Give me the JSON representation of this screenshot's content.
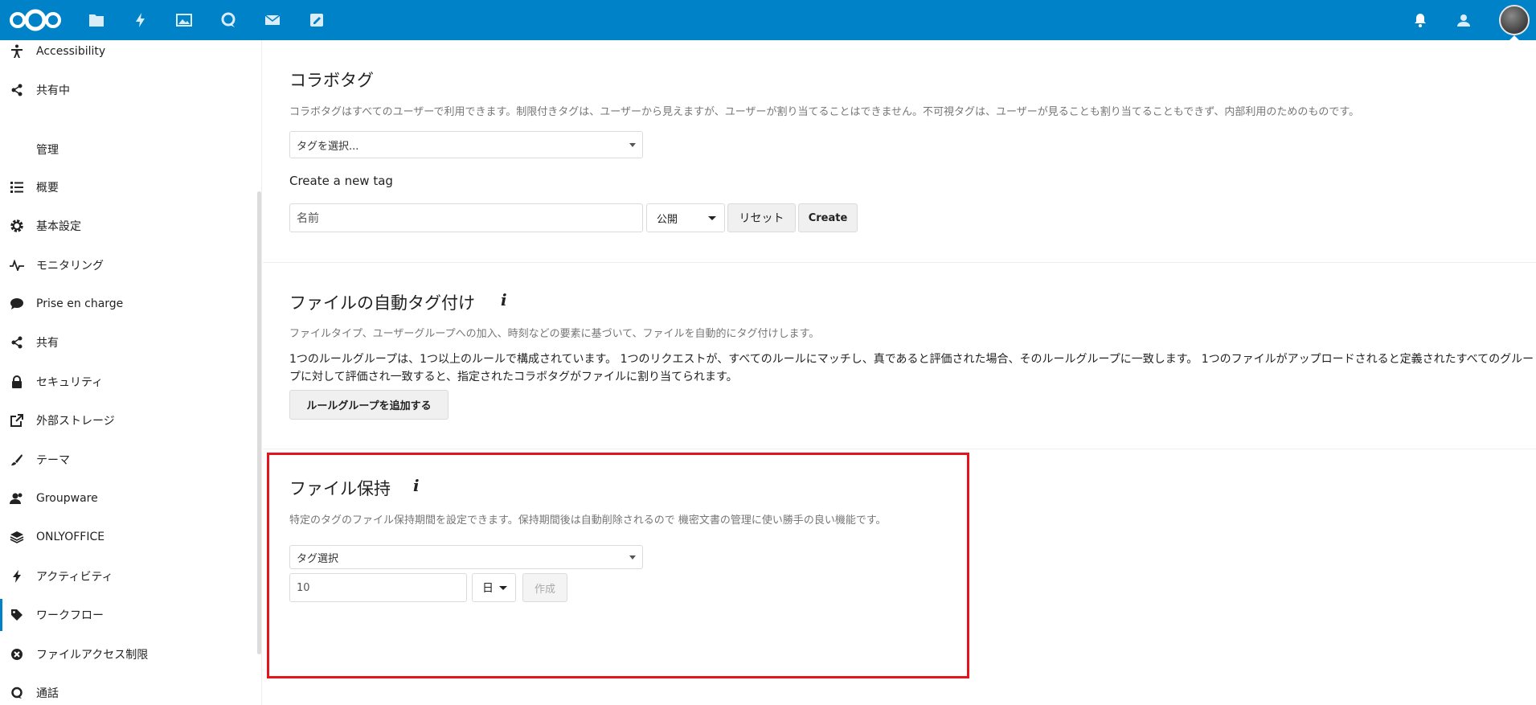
{
  "header": {
    "brand_color": "#0082c9",
    "apps": [
      {
        "icon": "files-icon"
      },
      {
        "icon": "activity-icon"
      },
      {
        "icon": "photos-icon"
      },
      {
        "icon": "talk-icon"
      },
      {
        "icon": "mail-icon"
      },
      {
        "icon": "notes-icon"
      }
    ],
    "right_icons": [
      "notifications-icon",
      "contacts-icon"
    ]
  },
  "sidebar": {
    "section_heading": "管理",
    "items": [
      {
        "label": "Accessibility",
        "icon": "accessibility-icon"
      },
      {
        "label": "共有中",
        "icon": "share-icon"
      },
      {
        "label": "概要",
        "icon": "list-icon"
      },
      {
        "label": "基本設定",
        "icon": "gear-icon"
      },
      {
        "label": "モニタリング",
        "icon": "pulse-icon"
      },
      {
        "label": "Prise en charge",
        "icon": "comment-icon"
      },
      {
        "label": "共有",
        "icon": "share-icon"
      },
      {
        "label": "セキュリティ",
        "icon": "lock-icon"
      },
      {
        "label": "外部ストレージ",
        "icon": "external-link-icon"
      },
      {
        "label": "テーマ",
        "icon": "brush-icon"
      },
      {
        "label": "Groupware",
        "icon": "group-icon"
      },
      {
        "label": "ONLYOFFICE",
        "icon": "layers-icon"
      },
      {
        "label": "アクティビティ",
        "icon": "activity-icon"
      },
      {
        "label": "ワークフロー",
        "icon": "tag-icon"
      },
      {
        "label": "ファイルアクセス制限",
        "icon": "block-icon"
      },
      {
        "label": "通話",
        "icon": "talk-icon"
      }
    ]
  },
  "collab_tags": {
    "title": "コラボタグ",
    "description": "コラボタグはすべてのユーザーで利用できます。制限付きタグは、ユーザーから見えますが、ユーザーが割り当てることはできません。不可視タグは、ユーザーが見ることも割り当てることもできず、内部利用のためのものです。",
    "select_placeholder": "タグを選択...",
    "create_label": "Create a new tag",
    "name_placeholder": "名前",
    "visibility_value": "公開",
    "reset_button": "リセット",
    "create_button": "Create"
  },
  "auto_tagging": {
    "title": "ファイルの自動タグ付け",
    "info_glyph": "i",
    "description": "ファイルタイプ、ユーザーグループへの加入、時刻などの要素に基づいて、ファイルを自動的にタグ付けします。",
    "body": "1つのルールグループは、1つ以上のルールで構成されています。 1つのリクエストが、すべてのルールにマッチし、真であると評価された場合、そのルールグループに一致します。 1つのファイルがアップロードされると定義されたすべてのグループに対して評価され一致すると、指定されたコラボタグがファイルに割り当てられます。",
    "add_button": "ルールグループを追加する"
  },
  "retention": {
    "title": "ファイル保持",
    "info_glyph": "i",
    "description": "特定のタグのファイル保持期間を設定できます。保持期間後は自動削除されるので 機密文書の管理に使い勝手の良い機能です。",
    "tag_select": "タグ選択",
    "amount_value": "10",
    "unit_value": "日",
    "create_button": "作成",
    "highlight_color": "#e3141c"
  }
}
